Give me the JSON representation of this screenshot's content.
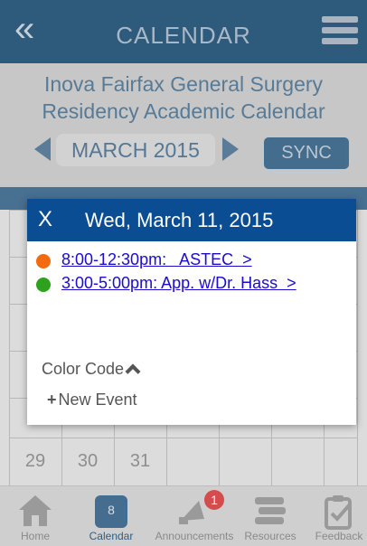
{
  "header": {
    "title": "CALENDAR"
  },
  "calendar": {
    "title_line1": "Inova Fairfax General Surgery",
    "title_line2": "Residency Academic Calendar",
    "month": "MARCH 2015",
    "sync_label": "SYNC",
    "visible_days": [
      "29",
      "30",
      "31"
    ]
  },
  "modal": {
    "close_label": "X",
    "date": "Wed, March 11, 2015",
    "events": [
      {
        "label": "8:00-12:30pm:   ASTEC  >",
        "color": "#f26b10"
      },
      {
        "label": "3:00-5:00pm: App. w/Dr. Hass  >",
        "color": "#2ea11e"
      }
    ],
    "divider": "____________________",
    "color_code_label": "Color Code",
    "new_event_label": "New Event"
  },
  "nav": {
    "items": [
      {
        "label": "Home",
        "icon": "home-icon"
      },
      {
        "label": "Calendar",
        "icon": "calendar-icon",
        "day": "8"
      },
      {
        "label": "Announcements",
        "icon": "megaphone-icon",
        "badge": "1"
      },
      {
        "label": "Resources",
        "icon": "books-icon"
      },
      {
        "label": "Feedback",
        "icon": "clipboard-check-icon"
      }
    ]
  },
  "colors": {
    "header_bg": "#2e5a7c",
    "modal_header_bg": "#0a4d93",
    "link": "#1a0bd0"
  }
}
